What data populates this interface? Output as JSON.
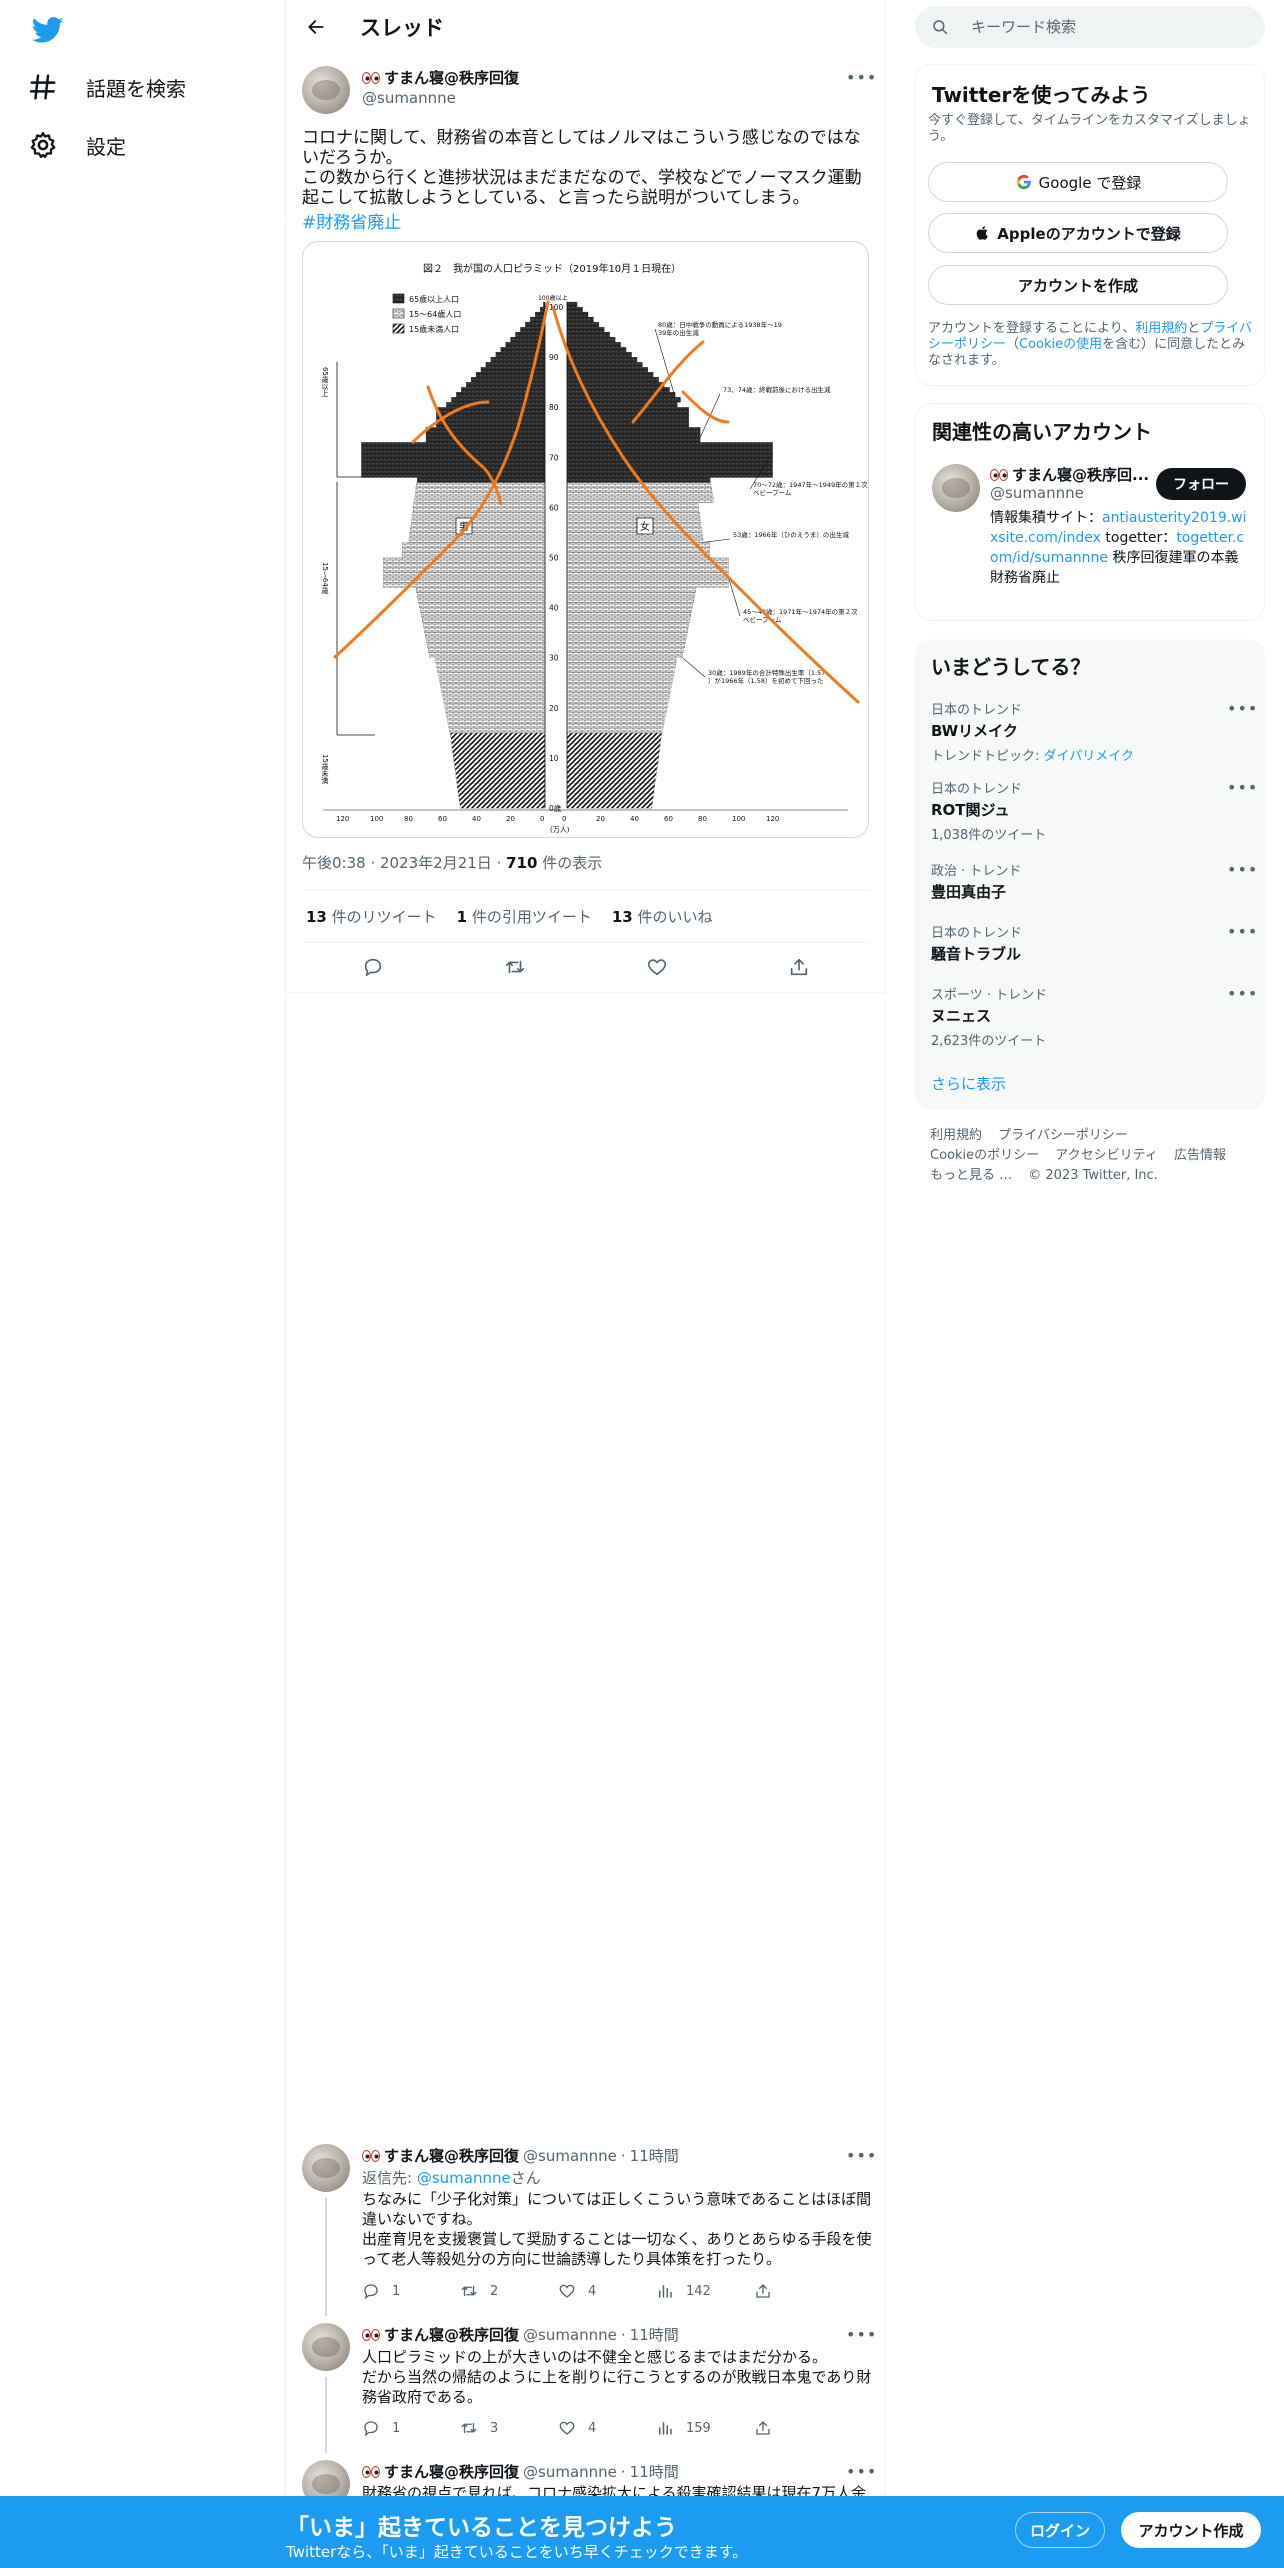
{
  "nav": {
    "explore_label": "話題を検索",
    "settings_label": "設定"
  },
  "header": {
    "title": "スレッド"
  },
  "main_tweet": {
    "display_name": "すまん寝@秩序回復",
    "handle": "@sumannne",
    "text": "コロナに関して、財務省の本音としてはノルマはこういう感じなのではないだろうか。\nこの数から行くと進捗状況はまだまだなので、学校などでノーマスク運動起こして拡散しようとしている、と言ったら説明がついてしまう。",
    "hashtag": "#財務省廃止",
    "meta_time": "午後0:38 · 2023年2月21日 · ",
    "meta_views_count": "710",
    "meta_views_label": " 件の表示",
    "retweets_count": "13",
    "retweets_label": " 件のリツイート",
    "quotes_count": "1",
    "quotes_label": " 件の引用ツイート",
    "likes_count": "13",
    "likes_label": " 件のいいね"
  },
  "pyramid_image": {
    "title": "図２　我が国の人口ピラミッド（2019年10月１日現在）",
    "legend": [
      "65歳以上人口",
      "15〜64歳人口",
      "15歳未満人口"
    ],
    "left_age_groups": [
      "65歳以上",
      "15〜64歳",
      "15歳未満"
    ],
    "male_label": "男",
    "female_label": "女",
    "top_label": "100歳以上",
    "bottom_label": "0歳",
    "unit_label": "(万人)",
    "age_ticks": [
      "100",
      "90",
      "80",
      "70",
      "60",
      "50",
      "40",
      "30",
      "20",
      "10",
      "0歳"
    ],
    "x_ticks_left": [
      "120",
      "100",
      "80",
      "60",
      "40",
      "20",
      "0"
    ],
    "x_ticks_right": [
      "0",
      "20",
      "40",
      "60",
      "80",
      "100",
      "120"
    ],
    "annotations": [
      "80歳：日中戦争の動員による1938年〜1939年の出生減",
      "73、74歳：終戦前後における出生減",
      "70〜72歳：1947年〜1949年の第１次ベビーブーム",
      "53歳：1966年（ひのえうま）の出生減",
      "45〜48歳：1971年〜1974年の第２次ベビーブーム",
      "30歳：1989年の合計特殊出生率（1.57）が1966年（1.58）を初めて下回った"
    ]
  },
  "replies": [
    {
      "display_name": "すまん寝@秩序回復",
      "handle": "@sumannne",
      "dot": "·",
      "time": "11時間",
      "reply_to_prefix": "返信先: ",
      "reply_to_handle": "@sumannne",
      "reply_to_suffix": "さん",
      "text": "ちなみに「少子化対策」については正しくこういう意味であることはほぼ間違いないですね。\n出産育児を支援褒賞して奨励することは一切なく、ありとあらゆる手段を使って老人等殺処分の方向に世論誘導したり具体策を打ったり。",
      "replies": "1",
      "retweets": "2",
      "likes": "4",
      "views": "142"
    },
    {
      "display_name": "すまん寝@秩序回復",
      "handle": "@sumannne",
      "dot": "·",
      "time": "11時間",
      "text": "人口ピラミッドの上が大きいのは不健全と感じるまではまだ分かる。\nだから当然の帰結のように上を削りに行こうとするのが敗戦日本鬼であり財務省政府である。",
      "replies": "1",
      "retweets": "3",
      "likes": "4",
      "views": "159"
    },
    {
      "display_name": "すまん寝@秩序回復",
      "handle": "@sumannne",
      "dot": "·",
      "time": "11時間",
      "text": "財務省の視点で見れば、コロナ感染拡大による殺害確認結果は現在7万人余"
    }
  ],
  "search": {
    "placeholder": "キーワード検索"
  },
  "signup_panel": {
    "title": "Twitterを使ってみよう",
    "subtitle": "今すぐ登録して、タイムラインをカスタマイズしましょう。",
    "google_button": "Google で登録",
    "apple_button": "Appleのアカウントで登録",
    "create_button": "アカウントを作成",
    "terms_prefix": "アカウントを登録することにより、",
    "terms_link": "利用規約",
    "terms_and": "と",
    "privacy_link": "プライバシーポリシー",
    "cookie_open": "（",
    "cookie_link": "Cookieの使用",
    "terms_suffix": "を含む）に同意したとみなされます。"
  },
  "related_panel": {
    "title": "関連性の高いアカウント",
    "display_name": "すまん寝@秩序回...",
    "handle": "@sumannne",
    "follow_button": "フォロー",
    "bio_prefix": "情報集積サイト：",
    "bio_link1": "antiausterity2019.wixsite.com/index",
    "bio_mid": " togetter：",
    "bio_link2": "togetter.com/id/sumannne",
    "bio_suffix": " 秩序回復建軍の本義 財務省廃止"
  },
  "trends_panel": {
    "title": "いまどうしてる？",
    "items": [
      {
        "category": "日本のトレンド",
        "name": "BWリメイク",
        "sub_prefix": "トレンドトピック: ",
        "sub_link": "ダイパリメイク"
      },
      {
        "category": "日本のトレンド",
        "name": "ROT関ジュ",
        "sub": "1,038件のツイート"
      },
      {
        "category": "政治 · トレンド",
        "name": "豊田真由子"
      },
      {
        "category": "日本のトレンド",
        "name": "騒音トラブル"
      },
      {
        "category": "スポーツ · トレンド",
        "name": "ヌニェス",
        "sub": "2,623件のツイート"
      }
    ],
    "show_more": "さらに表示"
  },
  "footer": {
    "terms": "利用規約",
    "privacy": "プライバシーポリシー",
    "cookie": "Cookieのポリシー",
    "accessibility": "アクセシビリティ",
    "ads": "広告情報",
    "more": "もっと見る …",
    "copyright": "© 2023 Twitter, Inc."
  },
  "bottom_bar": {
    "title": "「いま」起きていることを見つけよう",
    "subtitle": "Twitterなら、「いま」起きていることをいち早くチェックできます。",
    "login_button": "ログイン",
    "signup_button": "アカウント作成"
  },
  "colors": {
    "accent": "#1d9bf0",
    "text": "#0f1419",
    "muted": "#536471",
    "border": "#eff3f4",
    "scribble": "#f07a1e"
  }
}
